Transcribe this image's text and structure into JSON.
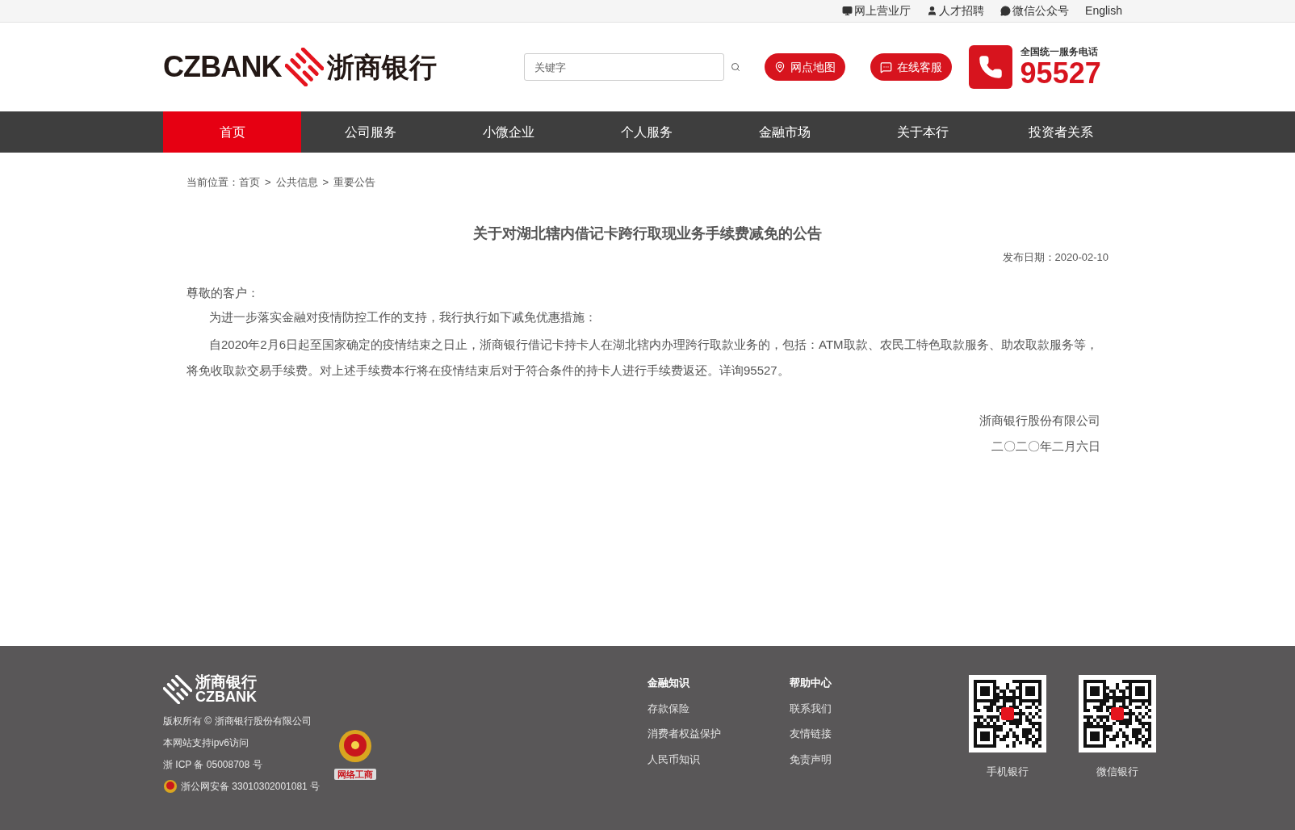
{
  "top_links": [
    {
      "kind": "monitor",
      "label": "网上营业厅"
    },
    {
      "kind": "user",
      "label": "人才招聘"
    },
    {
      "kind": "wechat",
      "label": "微信公众号"
    },
    {
      "kind": "plain",
      "label": "English"
    }
  ],
  "header": {
    "logo_latin": "CZBANK",
    "logo_chinese": "浙商银行",
    "search": {
      "placeholder": "关键字"
    },
    "buttons": [
      {
        "kind": "map",
        "label": "网点地图"
      },
      {
        "kind": "chat",
        "label": "在线客服"
      }
    ],
    "hotline": {
      "caption": "全国统一服务电话",
      "number": "95527"
    }
  },
  "nav": [
    {
      "label": "首页",
      "selected": true
    },
    {
      "label": "公司服务",
      "selected": false
    },
    {
      "label": "小微企业",
      "selected": false
    },
    {
      "label": "个人服务",
      "selected": false
    },
    {
      "label": "金融市场",
      "selected": false
    },
    {
      "label": "关于本行",
      "selected": false
    },
    {
      "label": "投资者关系",
      "selected": false
    }
  ],
  "breadcrumb": {
    "prefix": "当前位置：",
    "items": [
      "首页",
      "公共信息",
      "重要公告"
    ],
    "separator": ">"
  },
  "article": {
    "title": "关于对湖北辖内借记卡跨行取现业务手续费减免的公告",
    "date": "发布日期：2020-02-10",
    "salutation": "尊敬的客户：",
    "paragraphs": [
      "为进一步落实金融对疫情防控工作的支持，我行执行如下减免优惠措施：",
      "自2020年2月6日起至国家确定的疫情结束之日止，浙商银行借记卡持卡人在湖北辖内办理跨行取款业务的，包括：ATM取款、农民工特色取款服务、助农取款服务等，将免收取款交易手续费。对上述手续费本行将在疫情结束后对于符合条件的持卡人进行手续费返还。详询95527。"
    ],
    "signature": [
      "浙商银行股份有限公司",
      "二〇二〇年二月六日"
    ]
  },
  "footer": {
    "logo_chinese": "浙商银行",
    "logo_latin": "CZBANK",
    "info": [
      {
        "kind": "plain",
        "text": "版权所有 © 浙商银行股份有限公司"
      },
      {
        "kind": "plain",
        "text": "本网站支持ipv6访问"
      },
      {
        "kind": "plain",
        "text": "浙 ICP 备 05008708 号"
      },
      {
        "kind": "emblem",
        "text": "浙公网安备 33010302001081 号"
      }
    ],
    "badge_label": "网络工商",
    "link_columns": [
      {
        "heading": "金融知识",
        "links": [
          "存款保险",
          "消费者权益保护",
          "人民币知识"
        ]
      },
      {
        "heading": "帮助中心",
        "links": [
          "联系我们",
          "友情链接",
          "免责声明"
        ]
      }
    ],
    "qr_codes": [
      {
        "caption": "手机银行"
      },
      {
        "caption": "微信银行"
      }
    ]
  }
}
